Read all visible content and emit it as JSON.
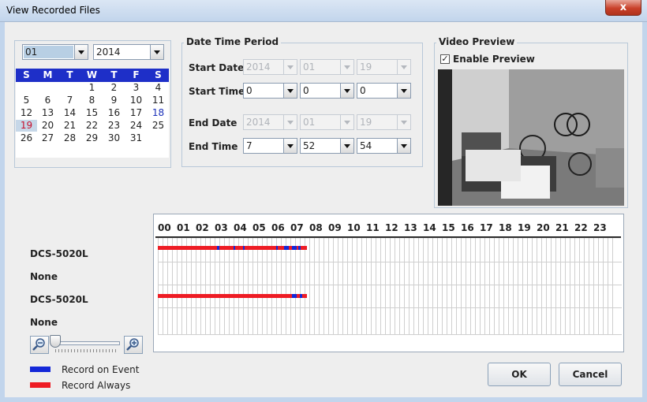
{
  "window": {
    "title": "View Recorded Files",
    "close_glyph": "x"
  },
  "calendar": {
    "month": "01",
    "year": "2014",
    "weekdays": [
      "S",
      "M",
      "T",
      "W",
      "T",
      "F",
      "S"
    ],
    "weeks": [
      [
        "",
        "",
        "",
        "1",
        "2",
        "3",
        "4"
      ],
      [
        "5",
        "6",
        "7",
        "8",
        "9",
        "10",
        "11"
      ],
      [
        "12",
        "13",
        "14",
        "15",
        "16",
        "17",
        "18"
      ],
      [
        "19",
        "20",
        "21",
        "22",
        "23",
        "24",
        "25"
      ],
      [
        "26",
        "27",
        "28",
        "29",
        "30",
        "31",
        ""
      ]
    ],
    "selected_day": "19",
    "highlight_day": "18"
  },
  "datetime": {
    "legend": "Date Time Period",
    "start_date_label": "Start Date",
    "start_time_label": "Start Time",
    "end_date_label": "End Date",
    "end_time_label": "End Time",
    "start_date": {
      "year": "2014",
      "month": "01",
      "day": "19"
    },
    "start_time": {
      "hour": "0",
      "minute": "0",
      "second": "0"
    },
    "end_date": {
      "year": "2014",
      "month": "01",
      "day": "19"
    },
    "end_time": {
      "hour": "7",
      "minute": "52",
      "second": "54"
    }
  },
  "preview": {
    "legend": "Video Preview",
    "enable_label": "Enable Preview",
    "enabled": true,
    "check_glyph": "✓"
  },
  "timeline": {
    "hours": [
      "00",
      "01",
      "02",
      "03",
      "04",
      "05",
      "06",
      "07",
      "08",
      "09",
      "10",
      "11",
      "12",
      "13",
      "14",
      "15",
      "16",
      "17",
      "18",
      "19",
      "20",
      "21",
      "22",
      "23"
    ],
    "tracks": [
      {
        "label": "DCS-5020L",
        "has_recording": true
      },
      {
        "label": "None",
        "has_recording": false
      },
      {
        "label": "DCS-5020L",
        "has_recording": true
      },
      {
        "label": "None",
        "has_recording": false
      }
    ]
  },
  "legend_items": {
    "event_label": "Record on Event",
    "always_label": "Record Always",
    "event_color": "#1428d8",
    "always_color": "#ee1c24"
  },
  "buttons": {
    "ok": "OK",
    "cancel": "Cancel"
  }
}
